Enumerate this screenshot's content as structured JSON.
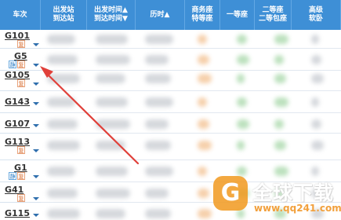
{
  "header": {
    "columns": [
      {
        "line1": "车次",
        "line2": ""
      },
      {
        "line1": "出发站",
        "line2": "到达站"
      },
      {
        "line1": "出发时间▲",
        "line2": "到达时间▼"
      },
      {
        "line1": "历时▲",
        "line2": ""
      },
      {
        "line1": "商务座",
        "line2": "特等座"
      },
      {
        "line1": "一等座",
        "line2": ""
      },
      {
        "line1": "二等座",
        "line2": "二等包座"
      },
      {
        "line1": "高级",
        "line2": "软卧"
      }
    ]
  },
  "trains": [
    {
      "number": "G101",
      "tags": [
        "复"
      ]
    },
    {
      "number": "G5",
      "tags": [
        "静",
        "复"
      ]
    },
    {
      "number": "G105",
      "tags": [
        "复"
      ]
    },
    {
      "number": "G143",
      "tags": []
    },
    {
      "number": "G107",
      "tags": []
    },
    {
      "number": "G113",
      "tags": [
        "复"
      ]
    },
    {
      "number": "G1",
      "tags": [
        "静",
        "复"
      ]
    },
    {
      "number": "G41",
      "tags": [
        "复"
      ]
    },
    {
      "number": "G115",
      "tags": []
    }
  ],
  "watermark": {
    "logo_letter": "G",
    "title": "全球下载",
    "url": "www.qq241.com"
  },
  "colors": {
    "header_bg": "#3e8fd6",
    "arrow": "#e0403a",
    "watermark_orange": "#f29a1f"
  }
}
